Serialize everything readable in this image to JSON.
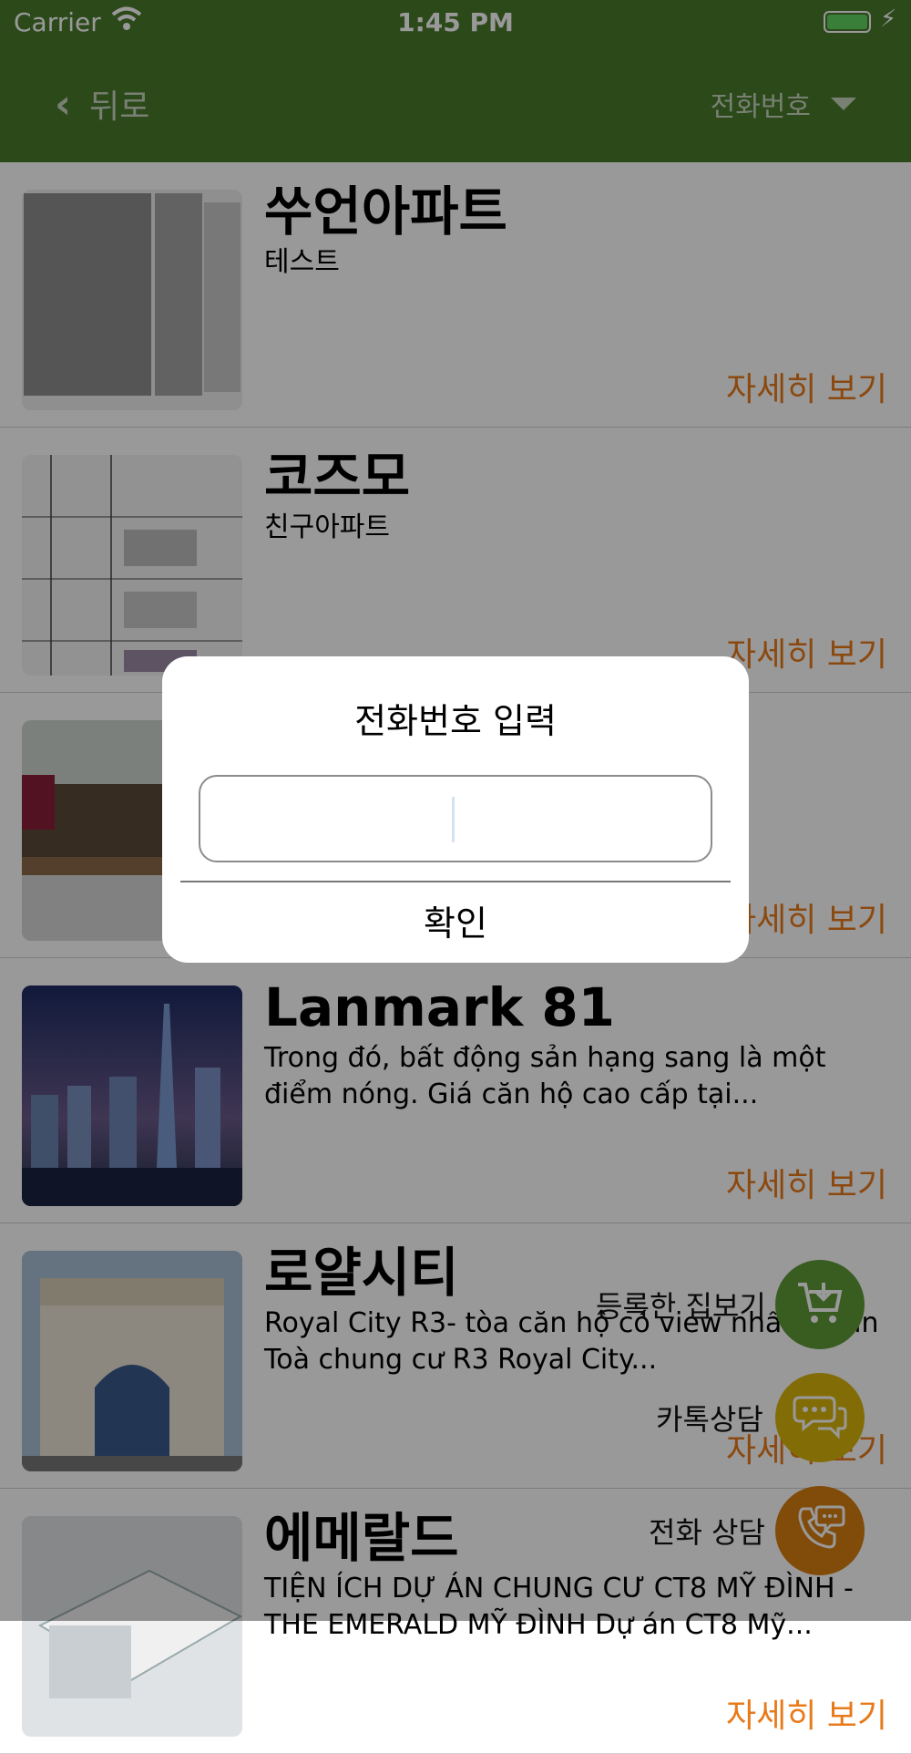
{
  "status_bar": {
    "carrier": "Carrier",
    "time": "1:45 PM"
  },
  "nav": {
    "back_label": "뒤로",
    "phone_label": "전화번호"
  },
  "list": {
    "more_label": "자세히 보기",
    "items": [
      {
        "title": "쑤언아파트",
        "desc": "테스트"
      },
      {
        "title": "코즈모",
        "desc": "친구아파트"
      },
      {
        "title": "",
        "desc": ""
      },
      {
        "title": "Lanmark 81",
        "desc": "Trong đó, bất động sản hạng sang là một điểm nóng. Giá căn hộ cao cấp tại..."
      },
      {
        "title": "로얄시티",
        "desc": "     Royal City R3- tòa căn hộ có view nhất dự án Toà chung cư R3 Royal City..."
      },
      {
        "title": "에메랄드",
        "desc": "TIỆN ÍCH DỰ ÁN CHUNG CƯ CT8 MỸ ĐÌNH - THE EMERALD MỸ ĐÌNH Dự án CT8 Mỹ..."
      }
    ]
  },
  "fabs": {
    "cart_label": "등록한 집보기",
    "kakao_label": "카톡상담",
    "call_label": "전화 상담",
    "colors": {
      "cart": "#5f9a37",
      "kakao": "#d9b40a",
      "call": "#d77d0f"
    }
  },
  "dialog": {
    "title": "전화번호 입력",
    "input_value": "",
    "confirm_label": "확인"
  }
}
